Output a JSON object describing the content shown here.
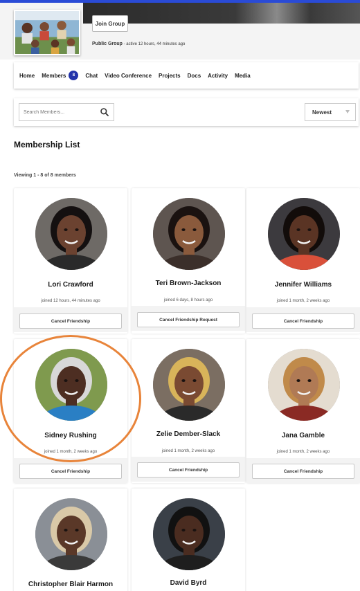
{
  "group": {
    "join_label": "Join Group",
    "type_label": "Public Group",
    "activity": " - active 12 hours, 44 minutes ago"
  },
  "nav": {
    "items": [
      {
        "label": "Home"
      },
      {
        "label": "Members",
        "badge": "8"
      },
      {
        "label": "Chat"
      },
      {
        "label": "Video Conference"
      },
      {
        "label": "Projects"
      },
      {
        "label": "Docs"
      },
      {
        "label": "Activity"
      },
      {
        "label": "Media"
      }
    ]
  },
  "search": {
    "placeholder": "Search Members..."
  },
  "sort": {
    "selected": "Newest"
  },
  "section": {
    "title": "Membership List",
    "viewing": "Viewing 1 - 8 of 8 members"
  },
  "members": [
    {
      "name": "Lori Crawford",
      "joined": "joined 12 hours, 44 minutes ago",
      "action": "Cancel Friendship",
      "bg": "#6e6a66",
      "skin": "#6b4230",
      "hair": "#141010",
      "shirt": "#2a2a2a"
    },
    {
      "name": "Teri Brown-Jackson",
      "joined": "joined 6 days, 8 hours ago",
      "action": "Cancel Friendship Request",
      "bg": "#5e5550",
      "skin": "#8a5a3c",
      "hair": "#1a1210",
      "shirt": "#3b2f2a"
    },
    {
      "name": "Jennifer Williams",
      "joined": "joined 1 month, 2 weeks ago",
      "action": "Cancel Friendship",
      "bg": "#3c3a3e",
      "skin": "#5a3424",
      "hair": "#120c0a",
      "shirt": "#d9503a"
    },
    {
      "name": "Sidney Rushing",
      "joined": "joined 1 month, 2 weeks ago",
      "action": "Cancel Friendship",
      "bg": "#7f9a4e",
      "skin": "#4d2e22",
      "hair": "#d8d8d8",
      "shirt": "#2a7fc4"
    },
    {
      "name": "Zelie Dember-Slack",
      "joined": "joined 1 month, 2 weeks ago",
      "action": "Cancel Friendship",
      "bg": "#7b6e62",
      "skin": "#7a4a32",
      "hair": "#d8b45a",
      "shirt": "#2a2a2a"
    },
    {
      "name": "Jana Gamble",
      "joined": "joined 1 month, 2 weeks ago",
      "action": "Cancel Friendship",
      "bg": "#e4dcd0",
      "skin": "#b07a55",
      "hair": "#c08a4a",
      "shirt": "#8a2a24"
    },
    {
      "name": "Christopher Blair Harmon",
      "joined": "",
      "action": "",
      "bg": "#8a8f96",
      "skin": "#5a3828",
      "hair": "#d9c9a8",
      "shirt": "#3a3a3a"
    },
    {
      "name": "David Byrd",
      "joined": "",
      "action": "",
      "bg": "#3a4048",
      "skin": "#4a2c20",
      "hair": "#111111",
      "shirt": "#1e1e1e"
    }
  ]
}
